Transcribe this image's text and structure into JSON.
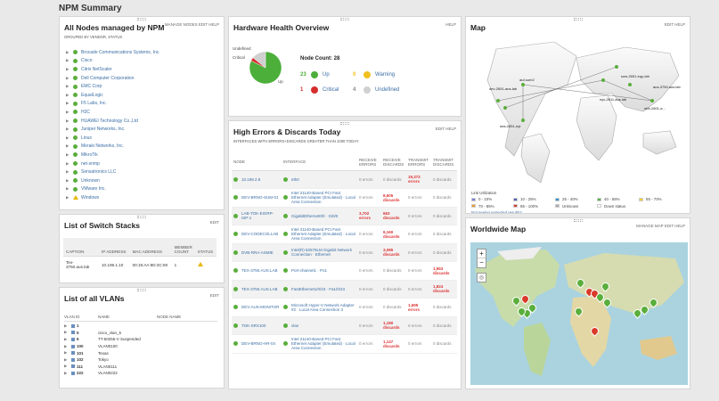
{
  "page_title": "NPM Summary",
  "nodes": {
    "title": "All Nodes managed by NPM",
    "actions": "MANAGE NODES  EDIT  HELP",
    "subtitle": "GROUPED BY VENDOR, STATUS",
    "items": [
      {
        "label": "Brocade Communications Systems, Inc.",
        "status": "up"
      },
      {
        "label": "Cisco",
        "status": "up"
      },
      {
        "label": "Citrix NetScaler",
        "status": "up"
      },
      {
        "label": "Dell Computer Corporation",
        "status": "up"
      },
      {
        "label": "EMC Corp",
        "status": "up"
      },
      {
        "label": "EqualLogic",
        "status": "up"
      },
      {
        "label": "F5 Labs, Inc.",
        "status": "up"
      },
      {
        "label": "H3C",
        "status": "up"
      },
      {
        "label": "HUAWEI Technology Co.,Ltd",
        "status": "up"
      },
      {
        "label": "Juniper Networks, Inc.",
        "status": "up"
      },
      {
        "label": "Linux",
        "status": "up"
      },
      {
        "label": "Meraki Networks, Inc.",
        "status": "up"
      },
      {
        "label": "MikroTik",
        "status": "up"
      },
      {
        "label": "net-snmp",
        "status": "up"
      },
      {
        "label": "Sensatronics LLC",
        "status": "up"
      },
      {
        "label": "Unknown",
        "status": "up"
      },
      {
        "label": "VMware Inc.",
        "status": "up"
      },
      {
        "label": "Windows",
        "status": "warning"
      }
    ]
  },
  "switch_stacks": {
    "title": "List of Switch Stacks",
    "actions": "EDIT",
    "headers": [
      "CAPTION",
      "IP ADDRESS",
      "MAC ADDRESS",
      "MEMBER COUNT",
      "STATUS"
    ],
    "rows": [
      {
        "caption": "Tex-3750.aus.lab",
        "ip": "10.199.1.10",
        "mac": "00:19:AA:8D:3C:80",
        "count": "1"
      }
    ]
  },
  "vlans": {
    "title": "List of all VLANs",
    "actions": "EDIT",
    "headers": [
      "VLAN ID",
      "NAME",
      "NODE NAME"
    ],
    "rows": [
      {
        "id": "1",
        "name": ""
      },
      {
        "id": "5",
        "name": "cisco_vlan_5"
      },
      {
        "id": "6",
        "name": "TT-50255-V Suspended"
      },
      {
        "id": "100",
        "name": "VLAN0100"
      },
      {
        "id": "101",
        "name": "Texas"
      },
      {
        "id": "102",
        "name": "Tokyo"
      },
      {
        "id": "111",
        "name": "VLAN0111"
      },
      {
        "id": "222",
        "name": "VLAN0222"
      }
    ]
  },
  "hardware": {
    "title": "Hardware Health Overview",
    "actions": "HELP",
    "pie_labels": {
      "undefined": "Undefined",
      "critical": "Critical",
      "up": "Up"
    },
    "node_count": "Node Count: 28",
    "stats": [
      {
        "num": "23",
        "label": "Up",
        "color": "#4caf3a"
      },
      {
        "num": "0",
        "label": "Warning",
        "color": "#f0c020"
      },
      {
        "num": "1",
        "label": "Critical",
        "color": "#d62d2d"
      },
      {
        "num": "4",
        "label": "Undefined",
        "color": "#d0d0d0"
      }
    ]
  },
  "errors": {
    "title": "High Errors & Discards Today",
    "actions": "EDIT  HELP",
    "subtitle": "INTERFACES WITH ERRORS+DISCARDS GREATER THAN 1000 TODAY",
    "headers": [
      "NODE",
      "INTERFACE",
      "RECEIVE ERRORS",
      "RECEIVE DISCARDS",
      "TRANSMIT ERRORS",
      "TRANSMIT DISCARDS"
    ],
    "rows": [
      {
        "node": "10.199.2.8",
        "iface": "eth0",
        "re": "0 errors",
        "rd": "0 discards",
        "te": "19,372 errors",
        "td": "0 discards"
      },
      {
        "node": "DEV-BRNO-SUM-01",
        "iface": "Intel 21140-Based PCI Fast Ethernet Adapter (Emulated) · Local Area Connection",
        "re": "0 errors",
        "rd": "8,605 discards",
        "te": "0 errors",
        "td": "0 discards"
      },
      {
        "node": "LAB-TOK-EIGRP-ISP-1",
        "iface": "GigabitEthernet0/0 · Gi0/0",
        "re": "3,702 errors",
        "rd": "663 discards",
        "te": "0 errors",
        "td": "0 discards"
      },
      {
        "node": "DEV-CODECOLLAB",
        "iface": "Intel 21140-Based PCI Fast Ethernet Adapter (Emulated) · Local Area Connection",
        "re": "0 errors",
        "rd": "6,160 discards",
        "te": "0 errors",
        "td": "0 discards"
      },
      {
        "node": "DVB-RRA-ASMIE",
        "iface": "Intel(R) 82579LM Gigabit Network Connection · Ethernet",
        "re": "0 errors",
        "rd": "3,085 discards",
        "te": "0 errors",
        "td": "0 discards"
      },
      {
        "node": "TEX-3750.AUS.LAB",
        "iface": "Port-channel1 · Po1",
        "re": "0 errors",
        "rd": "0 discards",
        "te": "0 errors",
        "td": "1,953 discards"
      },
      {
        "node": "TEX-3750.AUS.LAB",
        "iface": "FastEthernet1/0/23 · Fa1/0/23",
        "re": "0 errors",
        "rd": "0 discards",
        "te": "0 errors",
        "td": "1,824 discards"
      },
      {
        "node": "DEV-AUS-MONITOR",
        "iface": "Microsoft Hyper-V Network Adapter #2 · Local Area Connection 3",
        "re": "0 errors",
        "rd": "0 discards",
        "te": "1,695 errors",
        "td": "0 discards"
      },
      {
        "node": "TOK-SRX100",
        "iface": "vlan",
        "re": "0 errors",
        "rd": "1,180 discards",
        "te": "0 errors",
        "td": "0 discards"
      },
      {
        "node": "DEV-BRNO-HR-04",
        "iface": "Intel 21140-Based PCI Fast Ethernet Adapter (Emulated) · Local Area Connection",
        "re": "0 errors",
        "rd": "1,147 discards",
        "te": "0 errors",
        "td": "0 discards"
      }
    ]
  },
  "map": {
    "title": "Map",
    "actions": "EDIT  HELP",
    "node_labels": [
      "dev-2651-aus-lab",
      "auf-sum2",
      "sow-2651-eqy-lab",
      "aus-3750.aus.lab",
      "nyc-2811.aus.lab",
      "obb-2801-a...",
      "sea-2651-nyt"
    ],
    "legend_title": "Link Utilization",
    "legend": [
      {
        "label": "0 - 10%",
        "color": "#7d7dd6"
      },
      {
        "label": "10 - 25%",
        "color": "#4f5fb0"
      },
      {
        "label": "25 - 40%",
        "color": "#2c8fd0"
      },
      {
        "label": "40 - 55%",
        "color": "#58b04a"
      },
      {
        "label": "55 - 70%",
        "color": "#f2d030"
      },
      {
        "label": "70 - 85%",
        "color": "#ee9a2a"
      },
      {
        "label": "85 - 100%",
        "color": "#d93a2a"
      },
      {
        "label": "Unknown",
        "color": "#aaaaaa"
      },
      {
        "label": "Down status",
        "color": "#ffffff"
      }
    ],
    "legend_link": "Not seeing expected results?"
  },
  "worldwide": {
    "title": "Worldwide Map",
    "actions": "MANAGE MAP  EDIT  HELP",
    "zoom_in": "+",
    "zoom_out": "−"
  }
}
